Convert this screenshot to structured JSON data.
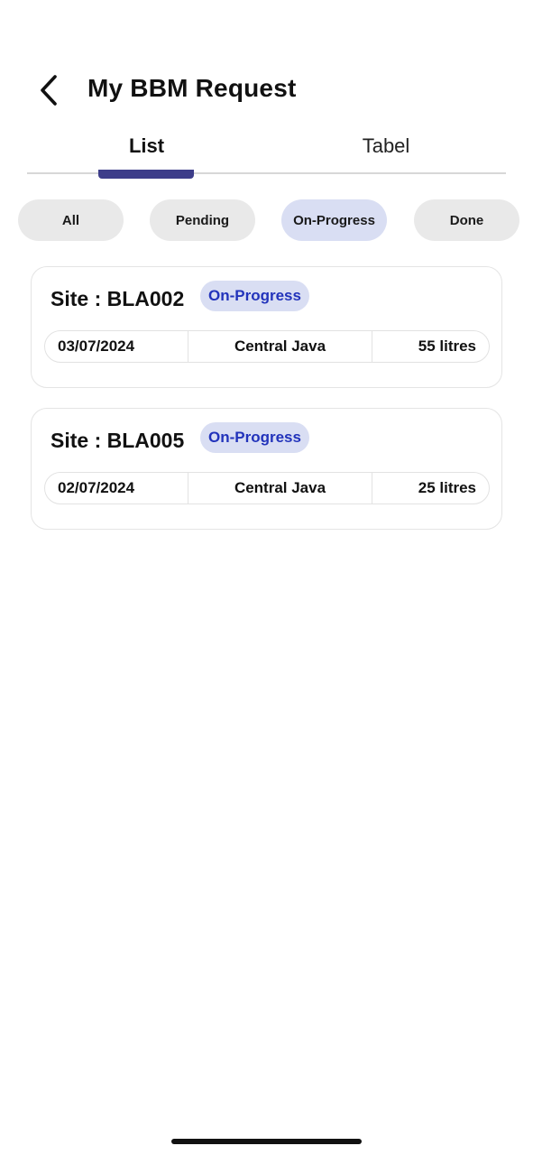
{
  "header": {
    "title": "My BBM Request",
    "back_icon": "chevron-left-icon"
  },
  "tabs": [
    {
      "label": "List",
      "active": true
    },
    {
      "label": "Tabel",
      "active": false
    }
  ],
  "filters": [
    {
      "label": "All",
      "active": false
    },
    {
      "label": "Pending",
      "active": false
    },
    {
      "label": "On-Progress",
      "active": true
    },
    {
      "label": "Done",
      "active": false
    }
  ],
  "requests": [
    {
      "site": "Site : BLA002",
      "status": "On-Progress",
      "date": "03/07/2024",
      "region": "Central Java",
      "volume": "55 litres"
    },
    {
      "site": "Site : BLA005",
      "status": "On-Progress",
      "date": "02/07/2024",
      "region": "Central Java",
      "volume": "25 litres"
    }
  ],
  "colors": {
    "accent": "#3d3d8a",
    "chip_active_bg": "#d9def3",
    "status_text": "#2233bb",
    "chip_bg": "#e9e9e9"
  }
}
